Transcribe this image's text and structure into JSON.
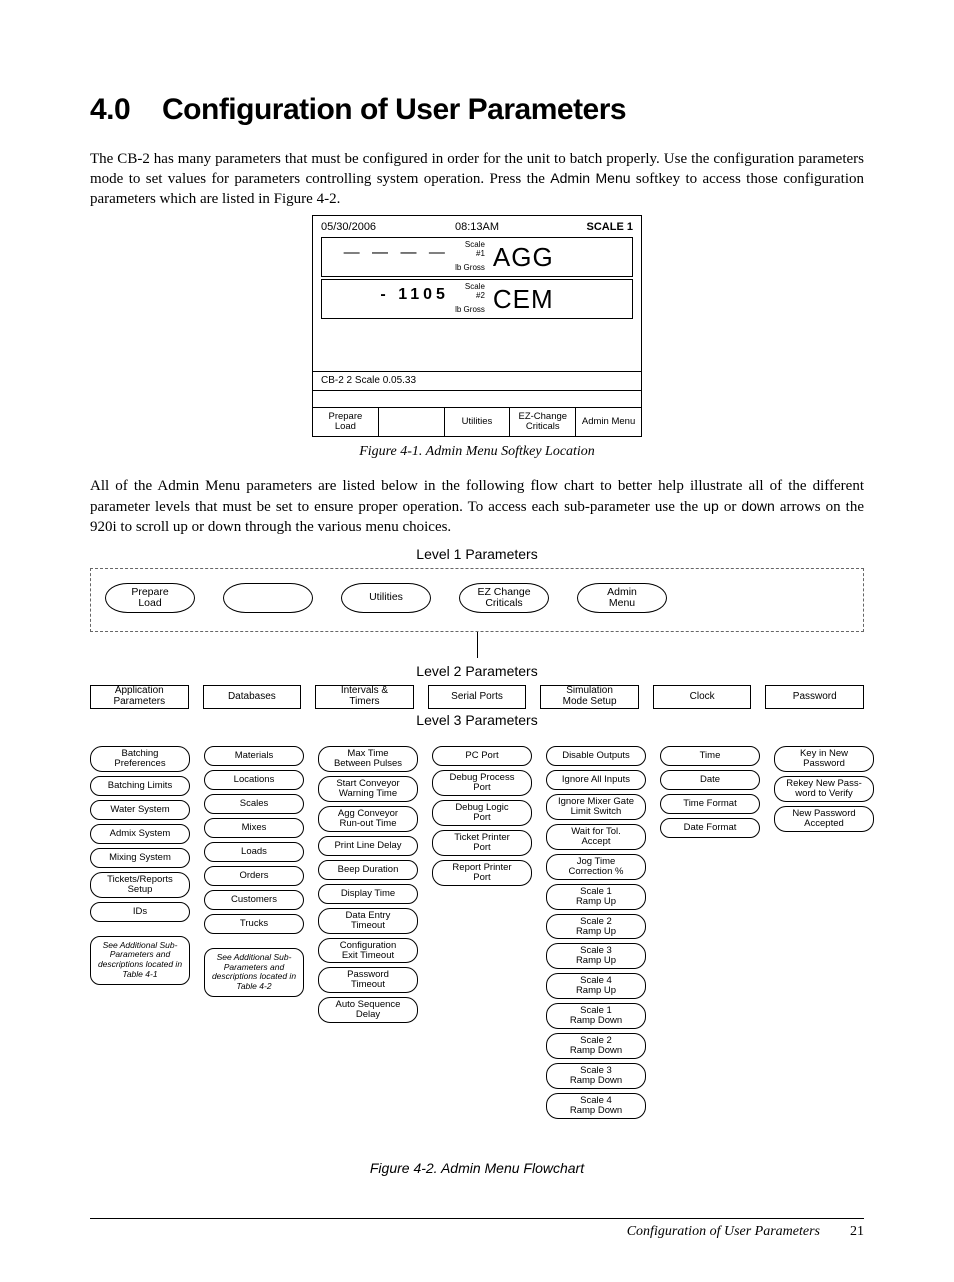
{
  "heading": {
    "number": "4.0",
    "title": "Configuration of User Parameters"
  },
  "intro": {
    "p1a": "The CB-2 has many parameters that must be configured in order for the unit to batch properly. Use the configuration parameters mode to set values for parameters controlling system operation. Press the ",
    "p1b": "Admin Menu",
    "p1c": " softkey to access those configuration parameters which are listed in Figure 4-2."
  },
  "fig1": {
    "date": "05/30/2006",
    "time": "08:13AM",
    "scale": "SCALE 1",
    "r1": {
      "dash": "— — — —",
      "s_top": "Scale\n#1",
      "s_bot": "lb  Gross",
      "big": "AGG"
    },
    "r2": {
      "dash": "- 1105",
      "s_top": "Scale\n#2",
      "s_bot": "lb  Gross",
      "big": "CEM"
    },
    "version": "CB-2  2 Scale  0.05.33",
    "sk": [
      "Prepare\nLoad",
      "",
      "Utilities",
      "EZ-Change\nCriticals",
      "Admin Menu"
    ],
    "caption": "Figure 4-1. Admin Menu Softkey Location"
  },
  "mid": {
    "p2a": "All of the Admin Menu parameters are listed below in the following flow chart to better help illustrate all of the different parameter levels that must be set to ensure proper operation. To access each sub-parameter use the ",
    "up": "up",
    "or": " or ",
    "down": "down",
    "p2b": " arrows on the 920i to scroll up or down through the various menu choices."
  },
  "flow": {
    "lvl1": "Level 1 Parameters",
    "lvl2": "Level 2 Parameters",
    "lvl3": "Level 3 Parameters",
    "ovals1": [
      "Prepare\nLoad",
      "",
      "Utilities",
      "EZ Change\nCriticals",
      "Admin\nMenu"
    ],
    "lvl2items": [
      "Application\nParameters",
      "Databases",
      "Intervals &\nTimers",
      "Serial Ports",
      "Simulation\nMode Setup",
      "Clock",
      "Password"
    ],
    "col0": [
      "Batching\nPreferences",
      "Batching Limits",
      "Water System",
      "Admix System",
      "Mixing System",
      "Tickets/Reports\nSetup",
      "IDs"
    ],
    "col1": [
      "Materials",
      "Locations",
      "Scales",
      "Mixes",
      "Loads",
      "Orders",
      "Customers",
      "Trucks"
    ],
    "col2": [
      "Max Time\nBetween Pulses",
      "Start Conveyor\nWarning Time",
      "Agg Conveyor\nRun-out Time",
      "Print Line Delay",
      "Beep Duration",
      "Display Time",
      "Data Entry\nTimeout",
      "Configuration\nExit Timeout",
      "Password\nTimeout",
      "Auto Sequence\nDelay"
    ],
    "col3": [
      "PC Port",
      "Debug Process\nPort",
      "Debug Logic\nPort",
      "Ticket Printer\nPort",
      "Report Printer\nPort"
    ],
    "col4": [
      "Disable Outputs",
      "Ignore All Inputs",
      "Ignore Mixer Gate\nLimit Switch",
      "Wait for Tol.\nAccept",
      "Jog Time\nCorrection %",
      "Scale 1\nRamp Up",
      "Scale 2\nRamp Up",
      "Scale 3\nRamp Up",
      "Scale 4\nRamp Up",
      "Scale 1\nRamp Down",
      "Scale 2\nRamp Down",
      "Scale 3\nRamp Down",
      "Scale 4\nRamp Down"
    ],
    "col5": [
      "Time",
      "Date",
      "Time Format",
      "Date Format"
    ],
    "col6": [
      "Key in New\nPassword",
      "Rekey New Pass-\nword to Verify",
      "New Password\nAccepted"
    ],
    "note0": "See Additional Sub-Parameters and descriptions located in Table 4-1",
    "note1": "See Additional Sub-Parameters and descriptions located in Table 4-2",
    "caption": "Figure 4-2. Admin Menu Flowchart"
  },
  "footer": {
    "section": "Configuration of User Parameters",
    "page": "21"
  }
}
